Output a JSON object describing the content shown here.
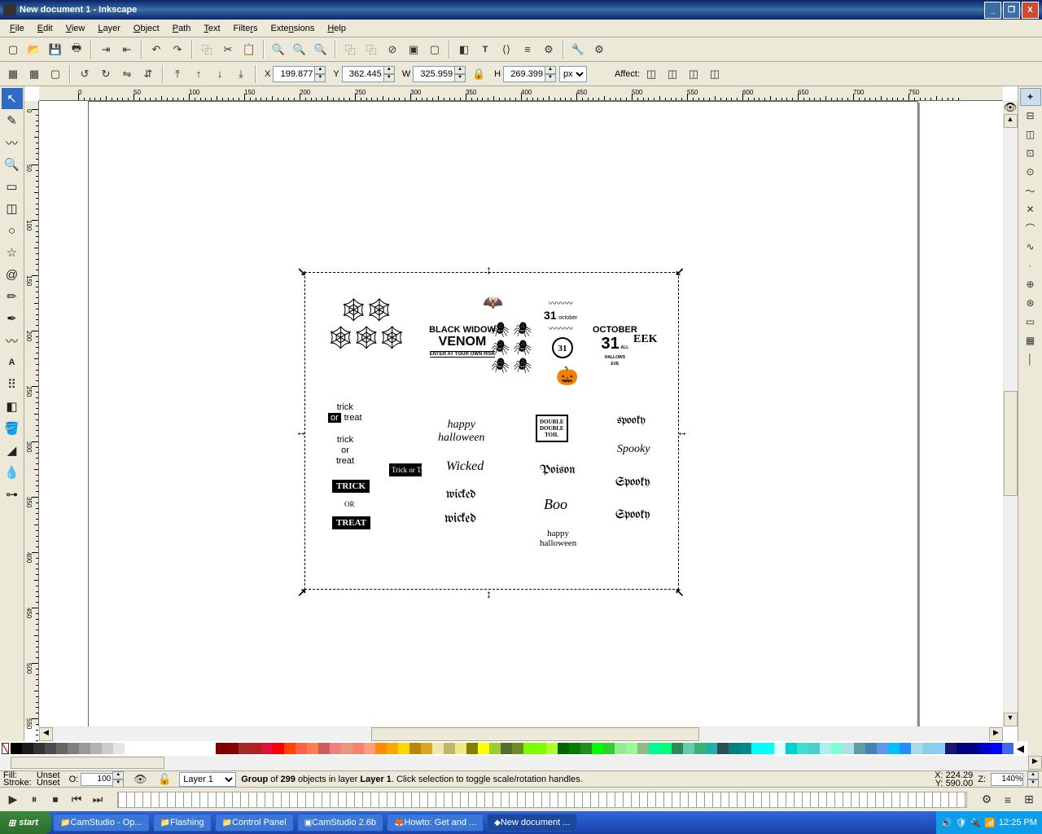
{
  "title": "New document 1 - Inkscape",
  "menu": [
    "File",
    "Edit",
    "View",
    "Layer",
    "Object",
    "Path",
    "Text",
    "Filters",
    "Extensions",
    "Help"
  ],
  "coords": {
    "x": "199.877",
    "y": "362.445",
    "w": "325.959",
    "h": "269.399",
    "unit": "px",
    "affect": "Affect:"
  },
  "lock_icon": "🔒",
  "status": {
    "fill": "Fill:",
    "fillv": "Unset",
    "stroke": "Stroke:",
    "strokev": "Unset",
    "o_label": "O:",
    "o": "100",
    "layer": "Layer 1",
    "msg_a": "Group",
    "msg_b": " of ",
    "msg_c": "299",
    "msg_d": " objects in layer ",
    "msg_e": "Layer 1",
    "msg_f": ". Click selection to toggle scale/rotation handles.",
    "cx": "X:",
    "cxv": "224.29",
    "cy": "Y:",
    "cyv": "590.00",
    "z_label": "Z:",
    "zoom": "140%"
  },
  "taskbar": {
    "start": "start",
    "tasks": [
      "CamStudio - Op...",
      "Flashing",
      "Control Panel",
      "CamStudio 2.6b",
      "Howto: Get and ...",
      "New document ..."
    ],
    "time": "12:25 PM"
  },
  "art": {
    "venom_a": "BLACK WIDOW",
    "venom_b": "VENOM",
    "venom_c": "ENTER AT YOUR OWN RISK",
    "n31": "31",
    "oct": "october",
    "oct2": "OCTOBER",
    "n31b": "31",
    "allh": "ALL\nHALLOWS\nEVE",
    "eek": "EEK",
    "trick1": "trick",
    "or": "or",
    "treat1": "treat",
    "trick2": "trick",
    "treat2": "treat",
    "trickb": "TRICK",
    "treatb": "TREAT",
    "trickc": "Trick or Treat",
    "ord": "OR",
    "treatd": "TREAT",
    "halloween": "happy\nhalloween",
    "wicked1": "Wicked",
    "wicked2": "wicked",
    "wicked3": "wicked",
    "box": "DOUBLE\nDOUBLE\nTOIL",
    "poison": "Poison",
    "boo": "Boo",
    "halloween2": "happy\nhalloween",
    "spooky1": "spooky",
    "spooky2": "Spooky",
    "spooky3": "Spooky",
    "spooky4": "Spooky"
  },
  "ruler_ticks": [
    "0",
    "50",
    "100",
    "150",
    "200",
    "250",
    "300",
    "350",
    "400",
    "450",
    "500",
    "550",
    "600",
    "650",
    "700",
    "750"
  ]
}
